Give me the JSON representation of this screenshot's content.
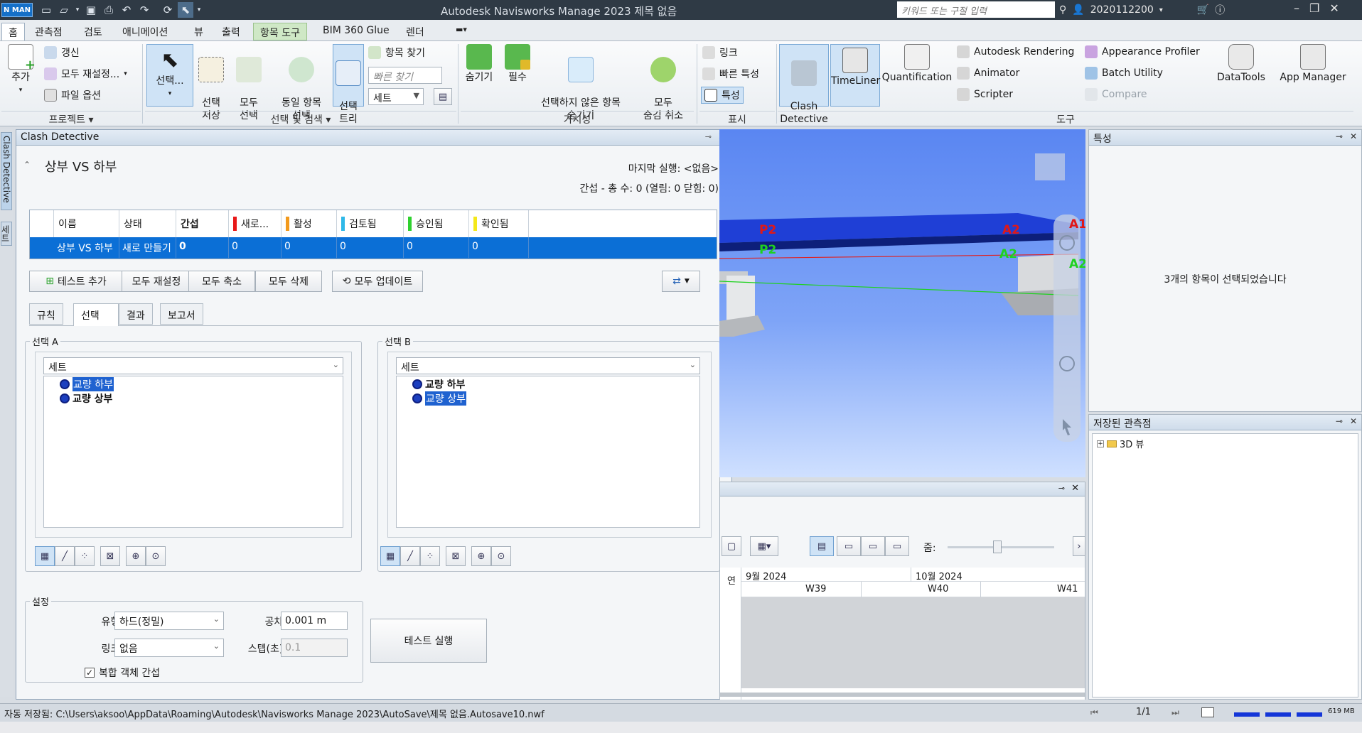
{
  "titlebar": {
    "logo": "N MAN",
    "title": "Autodesk Navisworks Manage 2023    제목 없음",
    "search_placeholder": "키워드 또는 구절 입력",
    "user": "2020112200"
  },
  "ribbon_tabs": [
    "홈",
    "관측점",
    "검토",
    "애니메이션",
    "뷰",
    "출력",
    "항목 도구",
    "BIM 360 Glue",
    "렌더"
  ],
  "ribbon": {
    "project": {
      "add": "추가",
      "refresh": "갱신",
      "reset_all": "모두 재설정...",
      "file_options": "파일 옵션",
      "group": "프로젝트 ▾"
    },
    "select": {
      "select": "선택...",
      "save_sel": "선택\n저장",
      "select_all": "모두\n선택",
      "same_sel": "동일 항목\n선택",
      "sel_tree": "선택\n트리",
      "find_items": "항목 찾기",
      "quick_find_ph": "빠른 찾기",
      "sets": "세트",
      "group": "선택 및 검색 ▾"
    },
    "visibility": {
      "hide": "숨기기",
      "required": "필수",
      "hide_unsel": "선택하지 않은 항목\n숨기기",
      "unhide_all": "모두\n숨김 취소",
      "group": "가시성"
    },
    "display": {
      "links": "링크",
      "quick_props": "빠른 특성",
      "props": "특성",
      "group": "표시"
    },
    "tools": {
      "clash": "Clash\nDetective",
      "timeliner": "TimeLiner",
      "quantification": "Quantification",
      "rendering": "Autodesk Rendering",
      "animator": "Animator",
      "scripter": "Scripter",
      "appearance": "Appearance Profiler",
      "batch": "Batch Utility",
      "compare": "Compare",
      "datatools": "DataTools",
      "appmanager": "App Manager",
      "group": "도구"
    }
  },
  "side_tabs": [
    "Clash Detective",
    "세트"
  ],
  "clash": {
    "panel_title": "Clash Detective",
    "test_name": "상부 VS 하부",
    "last_run": "마지막 실행: <없음>",
    "summary": "간섭 - 총 수: 0 (열림: 0 닫힘: 0)",
    "columns": [
      "이름",
      "상태",
      "간섭",
      "새로...",
      "활성",
      "검토됨",
      "승인됨",
      "확인됨"
    ],
    "column_colors": [
      "",
      "",
      "",
      "#e81919",
      "#f29a1d",
      "#2fb8e8",
      "#2fd12f",
      "#f4e81a"
    ],
    "row": [
      "상부 VS 하부",
      "새로 만들기",
      "0",
      "0",
      "0",
      "0",
      "0",
      "0"
    ],
    "buttons": {
      "add_test": "테스트 추가",
      "reset_all": "모두 재설정",
      "compact_all": "모두 축소",
      "delete_all": "모두 삭제",
      "update_all": "모두 업데이트"
    },
    "subtabs": [
      "규칙",
      "선택",
      "결과",
      "보고서"
    ],
    "selA": {
      "legend": "선택 A",
      "combo": "세트",
      "items": [
        "교량 하부",
        "교량 상부"
      ]
    },
    "selB": {
      "legend": "선택 B",
      "combo": "세트",
      "items": [
        "교량 하부",
        "교량 상부"
      ]
    },
    "settings": {
      "legend": "설정",
      "type_label": "유형:",
      "type_value": "하드(정밀)",
      "tolerance_label": "공차:",
      "tolerance_value": "0.001 m",
      "link_label": "링크:",
      "link_value": "없음",
      "step_label": "스텝(초):",
      "step_value": "0.1",
      "composite": "복합 객체 간섭"
    },
    "run_button": "테스트 실행"
  },
  "viewport": {
    "labels_red": [
      "P2",
      "A2",
      "A1"
    ],
    "labels_green": [
      "P2",
      "A2",
      "A2"
    ]
  },
  "timeliner": {
    "zoom_label": "줌:",
    "months": [
      "9월 2024",
      "10월 2024"
    ],
    "weeks": [
      "W39",
      "W40",
      "W41"
    ],
    "col_label": "연"
  },
  "properties": {
    "title": "특성",
    "message": "3개의 항목이 선택되었습니다"
  },
  "saved_viewpoints": {
    "title": "저장된 관측점",
    "item": "3D 뷰"
  },
  "status": {
    "autosave": "자동 저장됨: C:\\Users\\aksoo\\AppData\\Roaming\\Autodesk\\Navisworks Manage 2023\\AutoSave\\제목 없음.Autosave10.nwf",
    "page": "1/1",
    "memory": "619 MB"
  }
}
